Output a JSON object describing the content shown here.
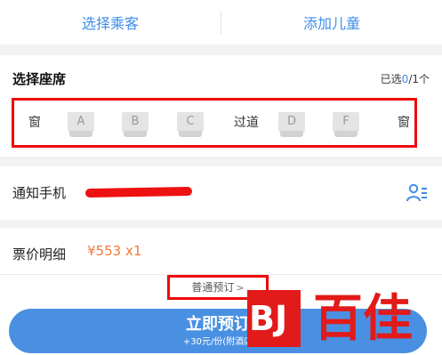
{
  "top_bar": {
    "select_passenger": "选择乘客",
    "add_child": "添加儿童"
  },
  "seat": {
    "title": "选择座席",
    "count_prefix": "已选",
    "count_selected": "0",
    "count_suffix": "/1个",
    "window_label": "窗",
    "aisle_label": "过道",
    "letters": [
      "A",
      "B",
      "C",
      "D",
      "F"
    ]
  },
  "phone": {
    "label": "通知手机"
  },
  "price": {
    "label": "票价明细",
    "value": "¥553 x1"
  },
  "booking": {
    "type_label": "普通预订",
    "button_label": "立即预订",
    "button_sub": "+30元/份(附酒店"
  },
  "watermark": {
    "mark": "BJ",
    "text": "百佳"
  },
  "colors": {
    "accent": "#3e8de8",
    "price": "#f5793a",
    "highlight_border": "#ee0a0a",
    "button": "#4a90e2"
  }
}
